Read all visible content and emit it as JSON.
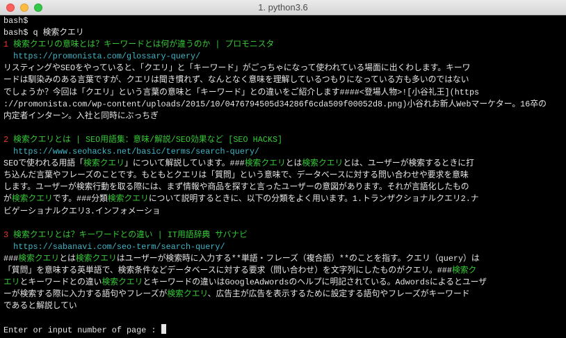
{
  "window": {
    "title": "1. python3.6"
  },
  "colors": {
    "background": "#000000",
    "text": "#e6e6e6",
    "number": "#e8392b",
    "title": "#36c837",
    "url": "#3fb6c6",
    "highlight": "#36c837"
  },
  "lines": [
    [
      {
        "t": "bash$",
        "c": "plain"
      }
    ],
    [
      {
        "t": "bash$ q 検索クエリ",
        "c": "plain"
      }
    ],
    [
      {
        "t": "1 ",
        "c": "num"
      },
      {
        "t": "検索クエリの意味とは？キーワードとは何が違うのか | プロモニスタ",
        "c": "title"
      }
    ],
    [
      {
        "t": "  ",
        "c": "plain"
      },
      {
        "t": "https://promonista.com/glossary-query/",
        "c": "url"
      }
    ],
    [
      {
        "t": "リスティングやSEOをやっていると、「クエリ」と「キーワード」がごっちゃになって使われている場面に出くわします。キーワ",
        "c": "plain"
      }
    ],
    [
      {
        "t": "ードは馴染みのある言葉ですが、クエリは聞き慣れず、なんとなく意味を理解しているつもりになっている方も多いのではない",
        "c": "plain"
      }
    ],
    [
      {
        "t": "でしょうか？今回は「クエリ」という言葉の意味と「キーワード」との違いをご紹介します####<登場人物>![小谷礼王](https",
        "c": "plain"
      }
    ],
    [
      {
        "t": "://promonista.com/wp-content/uploads/2015/10/0476794505d34286f6cda509f00052d8.png)小谷れお新人Webマーケター。16卒の",
        "c": "plain"
      }
    ],
    [
      {
        "t": "内定者インターン。入社と同時にぶっちぎ",
        "c": "plain"
      }
    ],
    [],
    [
      {
        "t": "2 ",
        "c": "num"
      },
      {
        "t": "検索クエリとは | SEO用語集：意味/解説/SEO効果など [SEO HACKS]",
        "c": "title"
      }
    ],
    [
      {
        "t": "  ",
        "c": "plain"
      },
      {
        "t": "https://www.seohacks.net/basic/terms/search-query/",
        "c": "url"
      }
    ],
    [
      {
        "t": "SEOで使われる用語「",
        "c": "plain"
      },
      {
        "t": "検索クエリ",
        "c": "hl"
      },
      {
        "t": "」について解説しています。###",
        "c": "plain"
      },
      {
        "t": "検索クエリ",
        "c": "hl"
      },
      {
        "t": "とは",
        "c": "plain"
      },
      {
        "t": "検索クエリ",
        "c": "hl"
      },
      {
        "t": "とは、ユーザーが検索するときに打",
        "c": "plain"
      }
    ],
    [
      {
        "t": "ち込んだ言葉やフレーズのことです。もともとクエリは「質問」という意味で、データベースに対する問い合わせや要求を意味",
        "c": "plain"
      }
    ],
    [
      {
        "t": "します。ユーザーが検索行動を取る際には、まず情報や商品を探すと言ったユーザーの意図があります。それが言語化したもの",
        "c": "plain"
      }
    ],
    [
      {
        "t": "が",
        "c": "plain"
      },
      {
        "t": "検索クエリ",
        "c": "hl"
      },
      {
        "t": "です。###分類",
        "c": "plain"
      },
      {
        "t": "検索クエリ",
        "c": "hl"
      },
      {
        "t": "について説明するときに、以下の分類をよく用います。1.トランザクショナルクエリ2.ナ",
        "c": "plain"
      }
    ],
    [
      {
        "t": "ビゲーショナルクエリ3.インフォメーショ",
        "c": "plain"
      }
    ],
    [],
    [
      {
        "t": "3 ",
        "c": "num"
      },
      {
        "t": "検索クエリとは？キーワードとの違い | IT用語辞典 サバナビ",
        "c": "title"
      }
    ],
    [
      {
        "t": "  ",
        "c": "plain"
      },
      {
        "t": "https://sabanavi.com/seo-term/search-query/",
        "c": "url"
      }
    ],
    [
      {
        "t": "###",
        "c": "plain"
      },
      {
        "t": "検索クエリ",
        "c": "hl"
      },
      {
        "t": "とは",
        "c": "plain"
      },
      {
        "t": "検索クエリ",
        "c": "hl"
      },
      {
        "t": "はユーザーが検索時に入力する**単語・フレーズ（複合語）**のことを指す。クエリ（query）は",
        "c": "plain"
      }
    ],
    [
      {
        "t": "「質問」を意味する英単語で、検索条件などデータベースに対する要求（問い合わせ）を文字列にしたものがクエリ。###",
        "c": "plain"
      },
      {
        "t": "検索ク",
        "c": "hl"
      }
    ],
    [
      {
        "t": "エリ",
        "c": "hl"
      },
      {
        "t": "とキーワードとの違い",
        "c": "plain"
      },
      {
        "t": "検索クエリ",
        "c": "hl"
      },
      {
        "t": "とキーワードの違いはGoogleAdwordsのヘルプに明記されている。Adwordsによるとユーザ",
        "c": "plain"
      }
    ],
    [
      {
        "t": "ーが検索する際に入力する語句やフレーズが",
        "c": "plain"
      },
      {
        "t": "検索クエリ",
        "c": "hl"
      },
      {
        "t": "、広告主が広告を表示するために設定する語句やフレーズがキーワード",
        "c": "plain"
      }
    ],
    [
      {
        "t": "であると解説してい",
        "c": "plain"
      }
    ],
    [],
    [
      {
        "t": "Enter or input number of page : ",
        "c": "plain"
      }
    ]
  ]
}
